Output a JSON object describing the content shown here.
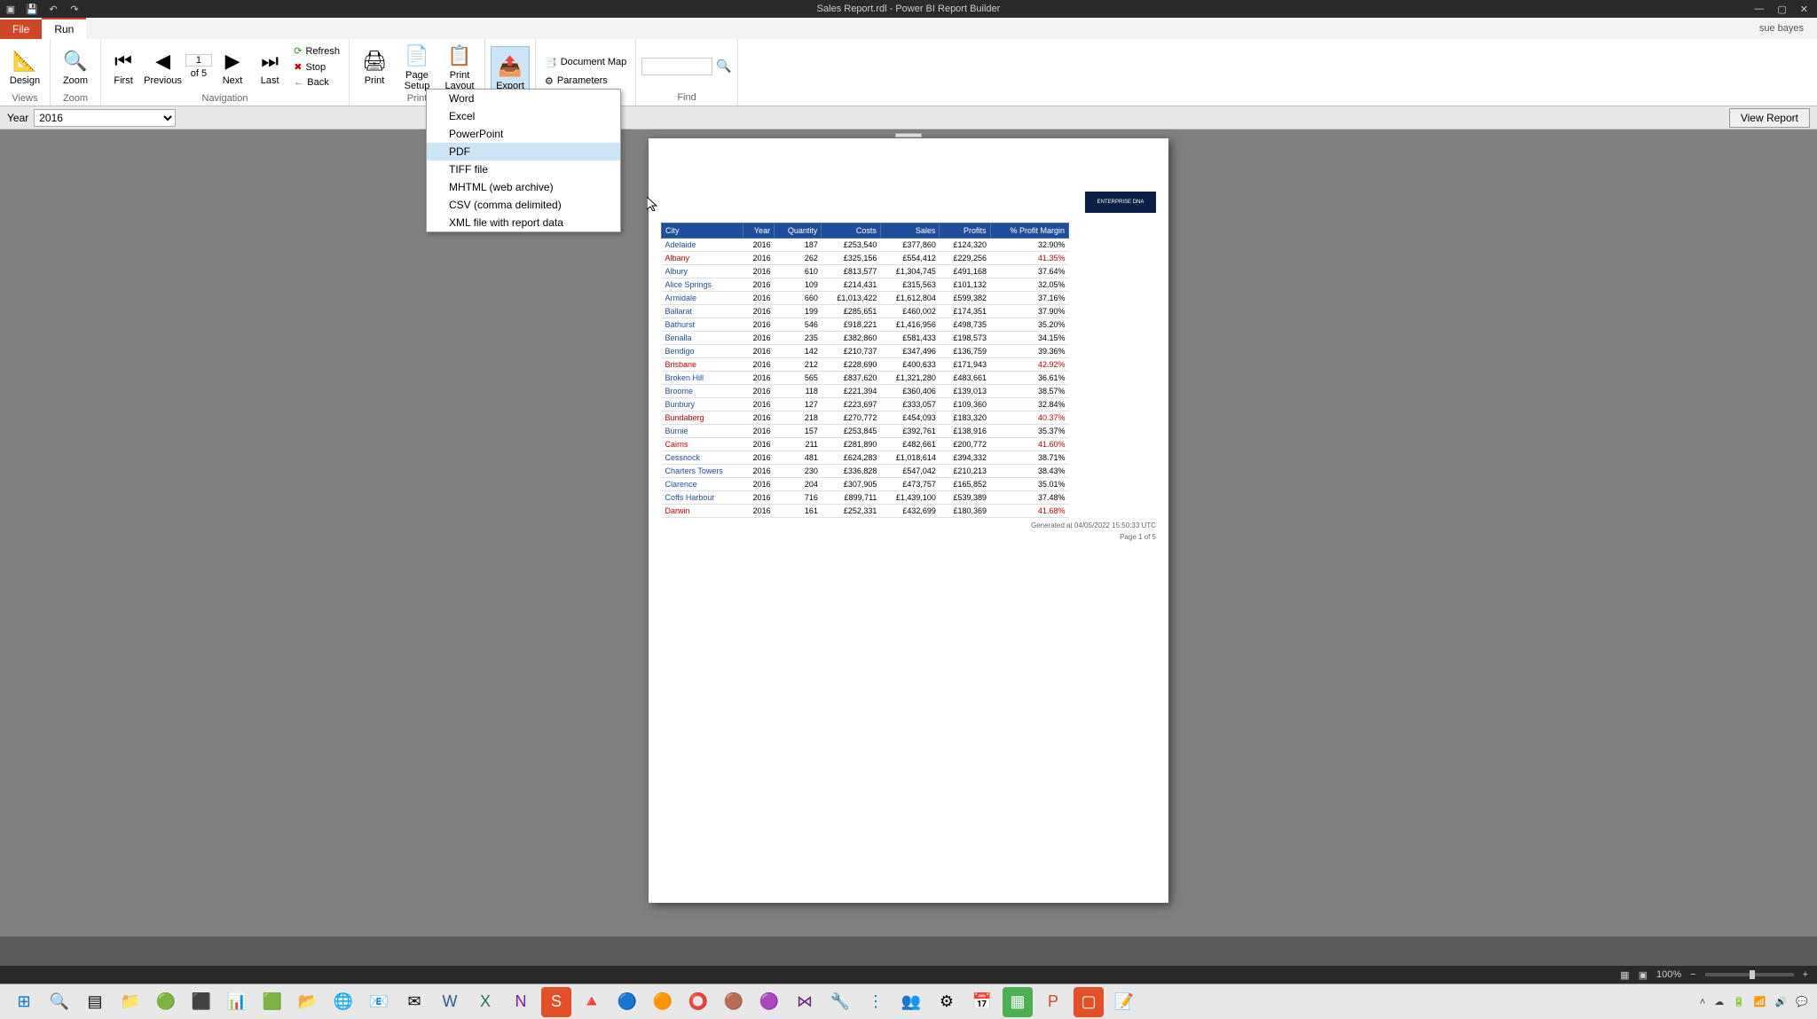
{
  "window": {
    "title": "Sales Report.rdl - Power BI Report Builder",
    "user": "sue bayes"
  },
  "tabs": {
    "file": "File",
    "run": "Run"
  },
  "ribbon": {
    "views": {
      "label": "Views",
      "design": "Design"
    },
    "zoom": {
      "label": "Zoom",
      "zoom": "Zoom"
    },
    "nav": {
      "label": "Navigation",
      "first": "First",
      "previous": "Previous",
      "page": "1",
      "of": "of  5",
      "next": "Next",
      "last": "Last",
      "refresh": "Refresh",
      "stop": "Stop",
      "back": "Back"
    },
    "print": {
      "label": "Print",
      "print": "Print",
      "pageSetup": "Page\nSetup",
      "printLayout": "Print\nLayout"
    },
    "export": {
      "label": "Export",
      "export": "Export"
    },
    "options": {
      "docMap": "Document Map",
      "parameters": "Parameters"
    },
    "find": {
      "label": "Find"
    }
  },
  "exportMenu": [
    "Word",
    "Excel",
    "PowerPoint",
    "PDF",
    "TIFF file",
    "MHTML (web archive)",
    "CSV (comma delimited)",
    "XML file with report data"
  ],
  "params": {
    "yearLabel": "Year",
    "yearValue": "2016",
    "viewReport": "View Report"
  },
  "report": {
    "logo": "ENTERPRISE DNA",
    "headers": [
      "City",
      "Year",
      "Quantity",
      "Costs",
      "Sales",
      "Profits",
      "% Profit Margin"
    ],
    "rows": [
      {
        "city": "Adelaide",
        "year": "2016",
        "qty": "187",
        "costs": "£253,540",
        "sales": "£377,860",
        "profits": "£124,320",
        "margin": "32.90%",
        "red": false
      },
      {
        "city": "Albany",
        "year": "2016",
        "qty": "262",
        "costs": "£325,156",
        "sales": "£554,412",
        "profits": "£229,256",
        "margin": "41.35%",
        "red": true
      },
      {
        "city": "Albury",
        "year": "2016",
        "qty": "610",
        "costs": "£813,577",
        "sales": "£1,304,745",
        "profits": "£491,168",
        "margin": "37.64%",
        "red": false
      },
      {
        "city": "Alice Springs",
        "year": "2016",
        "qty": "109",
        "costs": "£214,431",
        "sales": "£315,563",
        "profits": "£101,132",
        "margin": "32.05%",
        "red": false
      },
      {
        "city": "Armidale",
        "year": "2016",
        "qty": "660",
        "costs": "£1,013,422",
        "sales": "£1,612,804",
        "profits": "£599,382",
        "margin": "37.16%",
        "red": false
      },
      {
        "city": "Ballarat",
        "year": "2016",
        "qty": "199",
        "costs": "£285,651",
        "sales": "£460,002",
        "profits": "£174,351",
        "margin": "37.90%",
        "red": false
      },
      {
        "city": "Bathurst",
        "year": "2016",
        "qty": "546",
        "costs": "£918,221",
        "sales": "£1,416,956",
        "profits": "£498,735",
        "margin": "35.20%",
        "red": false
      },
      {
        "city": "Benalla",
        "year": "2016",
        "qty": "235",
        "costs": "£382,860",
        "sales": "£581,433",
        "profits": "£198,573",
        "margin": "34.15%",
        "red": false
      },
      {
        "city": "Bendigo",
        "year": "2016",
        "qty": "142",
        "costs": "£210,737",
        "sales": "£347,496",
        "profits": "£136,759",
        "margin": "39.36%",
        "red": false
      },
      {
        "city": "Brisbane",
        "year": "2016",
        "qty": "212",
        "costs": "£228,690",
        "sales": "£400,633",
        "profits": "£171,943",
        "margin": "42.92%",
        "red": true
      },
      {
        "city": "Broken Hill",
        "year": "2016",
        "qty": "565",
        "costs": "£837,620",
        "sales": "£1,321,280",
        "profits": "£483,661",
        "margin": "36.61%",
        "red": false
      },
      {
        "city": "Broome",
        "year": "2016",
        "qty": "118",
        "costs": "£221,394",
        "sales": "£360,406",
        "profits": "£139,013",
        "margin": "38.57%",
        "red": false
      },
      {
        "city": "Bunbury",
        "year": "2016",
        "qty": "127",
        "costs": "£223,697",
        "sales": "£333,057",
        "profits": "£109,360",
        "margin": "32.84%",
        "red": false
      },
      {
        "city": "Bundaberg",
        "year": "2016",
        "qty": "218",
        "costs": "£270,772",
        "sales": "£454,093",
        "profits": "£183,320",
        "margin": "40.37%",
        "red": true
      },
      {
        "city": "Burnie",
        "year": "2016",
        "qty": "157",
        "costs": "£253,845",
        "sales": "£392,761",
        "profits": "£138,916",
        "margin": "35.37%",
        "red": false
      },
      {
        "city": "Cairns",
        "year": "2016",
        "qty": "211",
        "costs": "£281,890",
        "sales": "£482,661",
        "profits": "£200,772",
        "margin": "41.60%",
        "red": true
      },
      {
        "city": "Cessnock",
        "year": "2016",
        "qty": "481",
        "costs": "£624,283",
        "sales": "£1,018,614",
        "profits": "£394,332",
        "margin": "38.71%",
        "red": false
      },
      {
        "city": "Charters Towers",
        "year": "2016",
        "qty": "230",
        "costs": "£336,828",
        "sales": "£547,042",
        "profits": "£210,213",
        "margin": "38.43%",
        "red": false
      },
      {
        "city": "Clarence",
        "year": "2016",
        "qty": "204",
        "costs": "£307,905",
        "sales": "£473,757",
        "profits": "£165,852",
        "margin": "35.01%",
        "red": false
      },
      {
        "city": "Coffs Harbour",
        "year": "2016",
        "qty": "716",
        "costs": "£899,711",
        "sales": "£1,439,100",
        "profits": "£539,389",
        "margin": "37.48%",
        "red": false
      },
      {
        "city": "Darwin",
        "year": "2016",
        "qty": "161",
        "costs": "£252,331",
        "sales": "£432,699",
        "profits": "£180,369",
        "margin": "41.68%",
        "red": true
      }
    ],
    "generated": "Generated at 04/05/2022 15:50:33 UTC",
    "pageInfo": "Page 1 of 5"
  },
  "statusbar": {
    "zoom": "100%"
  }
}
